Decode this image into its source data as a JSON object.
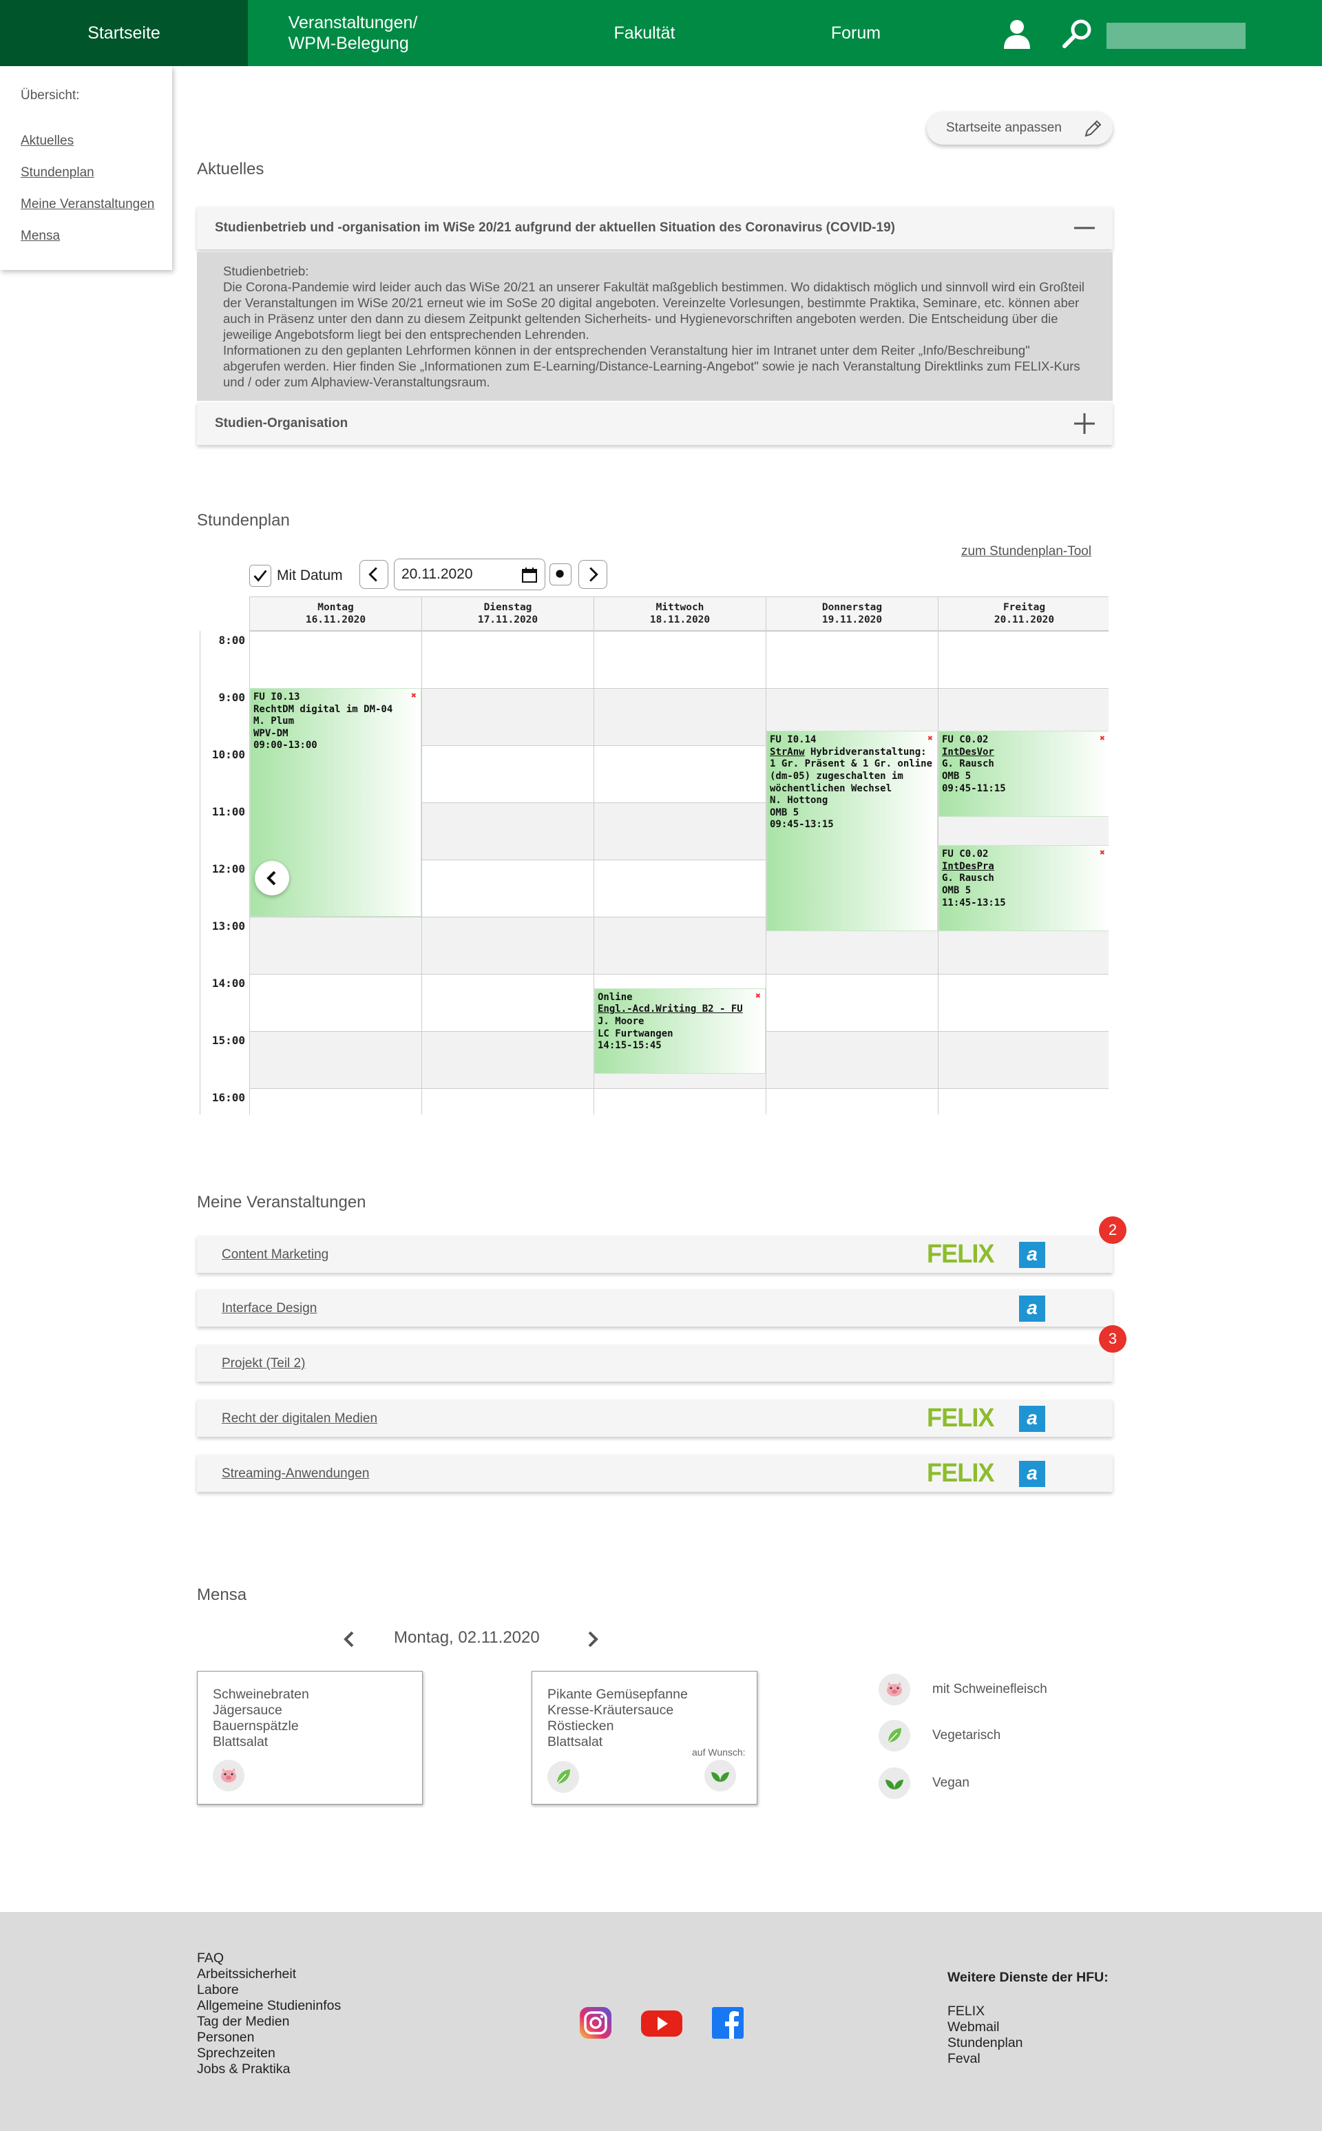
{
  "nav": {
    "home": "Startseite",
    "events_line1": "Veranstaltungen/",
    "events_line2": "WPM-Belegung",
    "faculty": "Fakultät",
    "forum": "Forum"
  },
  "sidemenu": {
    "heading": "Übersicht:",
    "items": [
      "Aktuelles",
      "Stundenplan",
      "Meine Veranstaltungen",
      "Mensa"
    ]
  },
  "customize_label": "Startseite anpassen",
  "news": {
    "title": "Aktuelles",
    "item1_title": "Studienbetrieb und -organisation im WiSe 20/21 aufgrund der aktuellen Situation des Coronavirus (COVID-19)",
    "item1_body": [
      "Studienbetrieb:",
      "Die Corona-Pandemie wird leider auch das WiSe 20/21 an unserer Fakultät maßgeblich bestimmen. Wo didaktisch möglich und sinnvoll wird ein Großteil der Veranstaltungen im WiSe 20/21 erneut wie im SoSe 20 digital angeboten. Vereinzelte Vorlesungen, bestimmte Praktika, Seminare, etc. können aber auch in Präsenz unter den dann zu diesem Zeitpunkt geltenden Sicherheits- und Hygienevorschriften angeboten werden. Die Entscheidung über die jeweilige Angebotsform liegt bei den entsprechenden Lehrenden.",
      "Informationen zu den geplanten Lehrformen können in der entsprechenden Veranstaltung hier im Intranet unter dem Reiter „Info/Beschreibung\" abgerufen werden. Hier finden Sie „Informationen zum E-Learning/Distance-Learning-Angebot\" sowie je nach Veranstaltung Direktlinks zum FELIX-Kurs und / oder zum Alphaview-Veranstaltungsraum."
    ],
    "item2_title": "Studien-Organisation"
  },
  "timetable": {
    "title": "Stundenplan",
    "tool_link": "zum Stundenplan-Tool",
    "with_date": "Mit Datum",
    "date_value": "20.11.2020",
    "days": [
      {
        "name": "Montag",
        "date": "16.11.2020"
      },
      {
        "name": "Dienstag",
        "date": "17.11.2020"
      },
      {
        "name": "Mittwoch",
        "date": "18.11.2020"
      },
      {
        "name": "Donnerstag",
        "date": "19.11.2020"
      },
      {
        "name": "Freitag",
        "date": "20.11.2020"
      }
    ],
    "times": [
      "8:00",
      "9:00",
      "10:00",
      "11:00",
      "12:00",
      "13:00",
      "14:00",
      "15:00",
      "16:00"
    ],
    "events": [
      {
        "day": 0,
        "start": 9.0,
        "end": 13.0,
        "lines": [
          "FU I0.13",
          "RechtDM digital im DM-04",
          "M. Plum",
          "WPV-DM",
          "09:00-13:00"
        ],
        "underline": []
      },
      {
        "day": 3,
        "start": 9.75,
        "end": 13.25,
        "lines": [
          "FU I0.14",
          "StrAnw Hybridveranstaltung:",
          "1 Gr. Präsent & 1 Gr. online",
          "(dm-05) zugeschalten im",
          "wöchentlichen Wechsel",
          "N. Hottong",
          "OMB 5",
          "09:45-13:15"
        ],
        "underline": [
          "StrAnw"
        ]
      },
      {
        "day": 4,
        "start": 9.75,
        "end": 11.25,
        "lines": [
          "FU C0.02",
          "IntDesVor",
          "G. Rausch",
          "OMB 5",
          "09:45-11:15"
        ],
        "underline": [
          "IntDesVor"
        ]
      },
      {
        "day": 4,
        "start": 11.75,
        "end": 13.25,
        "lines": [
          "FU C0.02",
          "IntDesPra",
          "G. Rausch",
          "OMB 5",
          "11:45-13:15"
        ],
        "underline": [
          "IntDesPra"
        ]
      },
      {
        "day": 2,
        "start": 14.25,
        "end": 15.75,
        "lines": [
          "Online",
          "Engl.-Acd.Writing B2 - FU",
          "J. Moore",
          "LC Furtwangen",
          "14:15-15:45"
        ],
        "underline": [
          "Engl.-Acd.Writing B2 - FU"
        ]
      }
    ]
  },
  "courses": {
    "title": "Meine Veranstaltungen",
    "felix_label": "FELIX",
    "alpha_label": "a",
    "items": [
      {
        "name": "Content Marketing",
        "felix": true,
        "alpha": true,
        "badge": "2"
      },
      {
        "name": "Interface Design",
        "felix": false,
        "alpha": true,
        "badge": ""
      },
      {
        "name": "Projekt (Teil 2)",
        "felix": false,
        "alpha": false,
        "badge": "3"
      },
      {
        "name": "Recht der digitalen Medien",
        "felix": true,
        "alpha": true,
        "badge": ""
      },
      {
        "name": "Streaming-Anwendungen",
        "felix": true,
        "alpha": true,
        "badge": ""
      }
    ]
  },
  "mensa": {
    "title": "Mensa",
    "date": "Montag, 02.11.2020",
    "meal1": [
      "Schweinebraten",
      "Jägersauce",
      "Bauernspätzle",
      "Blattsalat"
    ],
    "meal2": [
      "Pikante Gemüsepfanne",
      "Kresse-Kräutersauce",
      "Röstiecken",
      "Blattsalat"
    ],
    "on_request": "auf Wunsch:",
    "legend": [
      "mit Schweinefleisch",
      "Vegetarisch",
      "Vegan"
    ]
  },
  "footer": {
    "links": [
      "FAQ",
      "Arbeitssicherheit",
      "Labore",
      "Allgemeine Studieninfos",
      "Tag der Medien",
      "Personen",
      "Sprechzeiten",
      "Jobs & Praktika"
    ],
    "services_title": "Weitere Dienste der HFU:",
    "services": [
      "FELIX",
      "Webmail",
      "Stundenplan",
      "Feval"
    ]
  },
  "colors": {
    "brand_green": "#008a44",
    "active_green": "#00552a",
    "badge_red": "#e8322b",
    "felix_green": "#8cbd2c",
    "alpha_blue": "#1e94d2"
  }
}
